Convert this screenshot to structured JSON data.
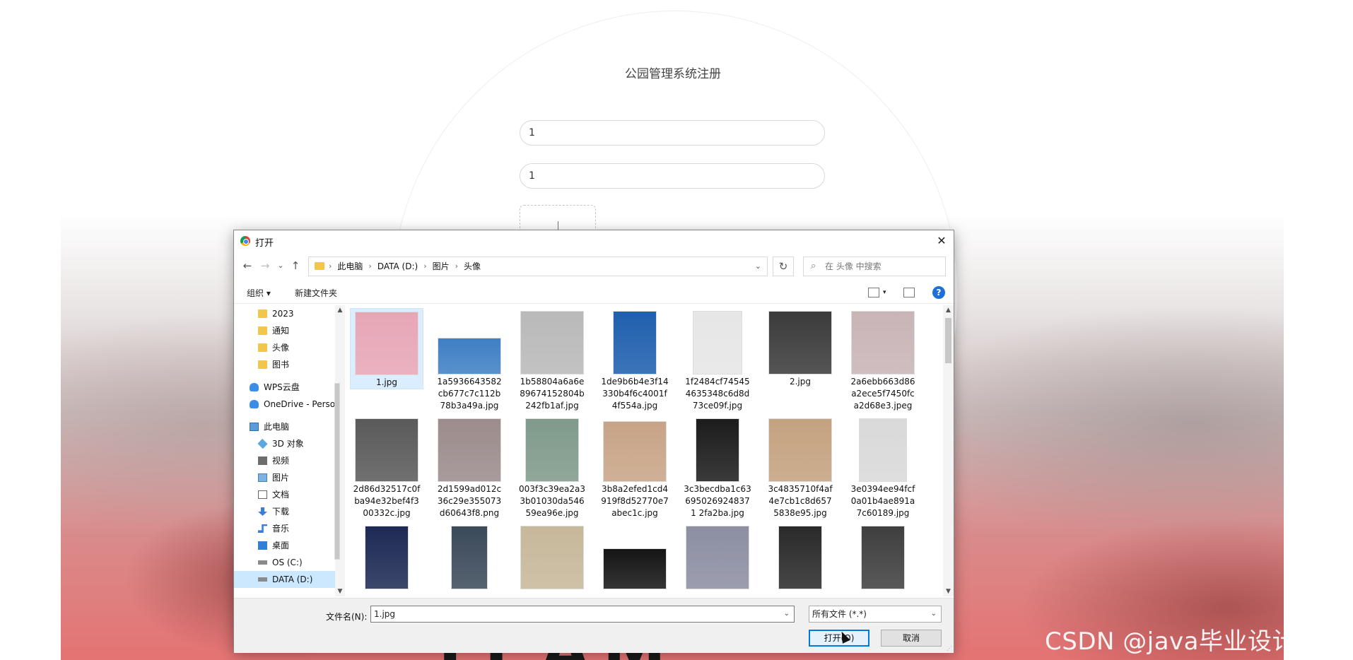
{
  "page": {
    "title": "公园管理系统注册",
    "username_value": "1",
    "password_value": "1",
    "bg_word": "TEAM"
  },
  "watermark": "CSDN @java毕业设计程序",
  "dialog": {
    "title": "打开",
    "close": "✕",
    "nav": {
      "back": "←",
      "forward": "→",
      "recent": "⌄",
      "up": "↑",
      "refresh": "↻"
    },
    "breadcrumb": [
      "此电脑",
      "DATA (D:)",
      "图片",
      "头像"
    ],
    "search_placeholder": "在 头像 中搜索",
    "toolbar": {
      "organize": "组织 ▾",
      "new_folder": "新建文件夹",
      "help": "?"
    },
    "tree": [
      {
        "label": "2023",
        "icon": "folder-icon",
        "indent": 1
      },
      {
        "label": "通知",
        "icon": "folder-icon",
        "indent": 1
      },
      {
        "label": "头像",
        "icon": "folder-icon",
        "indent": 1
      },
      {
        "label": "图书",
        "icon": "folder-icon",
        "indent": 1
      },
      {
        "label": "WPS云盘",
        "icon": "cloud-icon",
        "indent": 0
      },
      {
        "label": "OneDrive - Perso",
        "icon": "cloud-icon",
        "indent": 0
      },
      {
        "label": "此电脑",
        "icon": "computer-icon",
        "indent": 0
      },
      {
        "label": "3D 对象",
        "icon": "cube-icon",
        "indent": 1
      },
      {
        "label": "视频",
        "icon": "video-icon",
        "indent": 1
      },
      {
        "label": "图片",
        "icon": "picture-icon",
        "indent": 1
      },
      {
        "label": "文档",
        "icon": "document-icon",
        "indent": 1
      },
      {
        "label": "下载",
        "icon": "download-icon",
        "indent": 1
      },
      {
        "label": "音乐",
        "icon": "music-icon",
        "indent": 1
      },
      {
        "label": "桌面",
        "icon": "desktop-icon",
        "indent": 1
      },
      {
        "label": "OS (C:)",
        "icon": "drive-icon",
        "indent": 1
      },
      {
        "label": "DATA (D:)",
        "icon": "drive-icon",
        "indent": 1,
        "selected": true
      }
    ],
    "files": [
      {
        "name": "1.jpg",
        "selected": true,
        "color": "#e7a6b6"
      },
      {
        "name": "1a5936643582cb677c7c112b78b3a49a.jpg",
        "color": "#3f7fc4"
      },
      {
        "name": "1b58804a6a6e89674152804b242fb1af.jpg",
        "color": "#b9b9b9"
      },
      {
        "name": "1de9b6b4e3f14330b4f6c4001f4f554a.jpg",
        "color": "#1f5fae"
      },
      {
        "name": "1f2484cf745454635348c6d8d73ce09f.jpg",
        "color": "#e6e6e6"
      },
      {
        "name": "2.jpg",
        "color": "#3b3b3b"
      },
      {
        "name": "2a6ebb663d86a2ece5f7450fca2d68e3.jpeg",
        "color": "#c9b4b6"
      },
      {
        "name": "2d86d32517c0fba94e32bef4f300332c.jpg",
        "color": "#5a5a5a"
      },
      {
        "name": "2d1599ad012c36c29e355073d60643f8.png",
        "color": "#9c8c8c"
      },
      {
        "name": "003f3c39ea2a33b01030da54659ea96e.jpg",
        "color": "#7f9a8a"
      },
      {
        "name": "3b8a2efed1cd4919f8d52770e7abec1c.jpg",
        "color": "#c8a487"
      },
      {
        "name": "3c3becdba1c636950269248371 2fa2ba.jpg",
        "color": "#1c1c1c"
      },
      {
        "name": "3c4835710f4af4e7cb1c8d6575838e95.jpg",
        "color": "#c4a27f"
      },
      {
        "name": "3e0394ee94fcf0a01b4ae891a7c60189.jpg",
        "color": "#d9d9d9"
      },
      {
        "name": "",
        "color": "#1e2a55"
      },
      {
        "name": "",
        "color": "#3b4a5a"
      },
      {
        "name": "",
        "color": "#c7b89a"
      },
      {
        "name": "",
        "color": "#151515"
      },
      {
        "name": "",
        "color": "#8c8fa2"
      },
      {
        "name": "",
        "color": "#2a2a2a"
      },
      {
        "name": "",
        "color": "#3f3f3f"
      }
    ],
    "footer": {
      "filename_label": "文件名(N):",
      "filename_value": "1.jpg",
      "filetype_value": "所有文件 (*.*)",
      "open_button": "打开(O)",
      "cancel_button": "取消"
    }
  }
}
